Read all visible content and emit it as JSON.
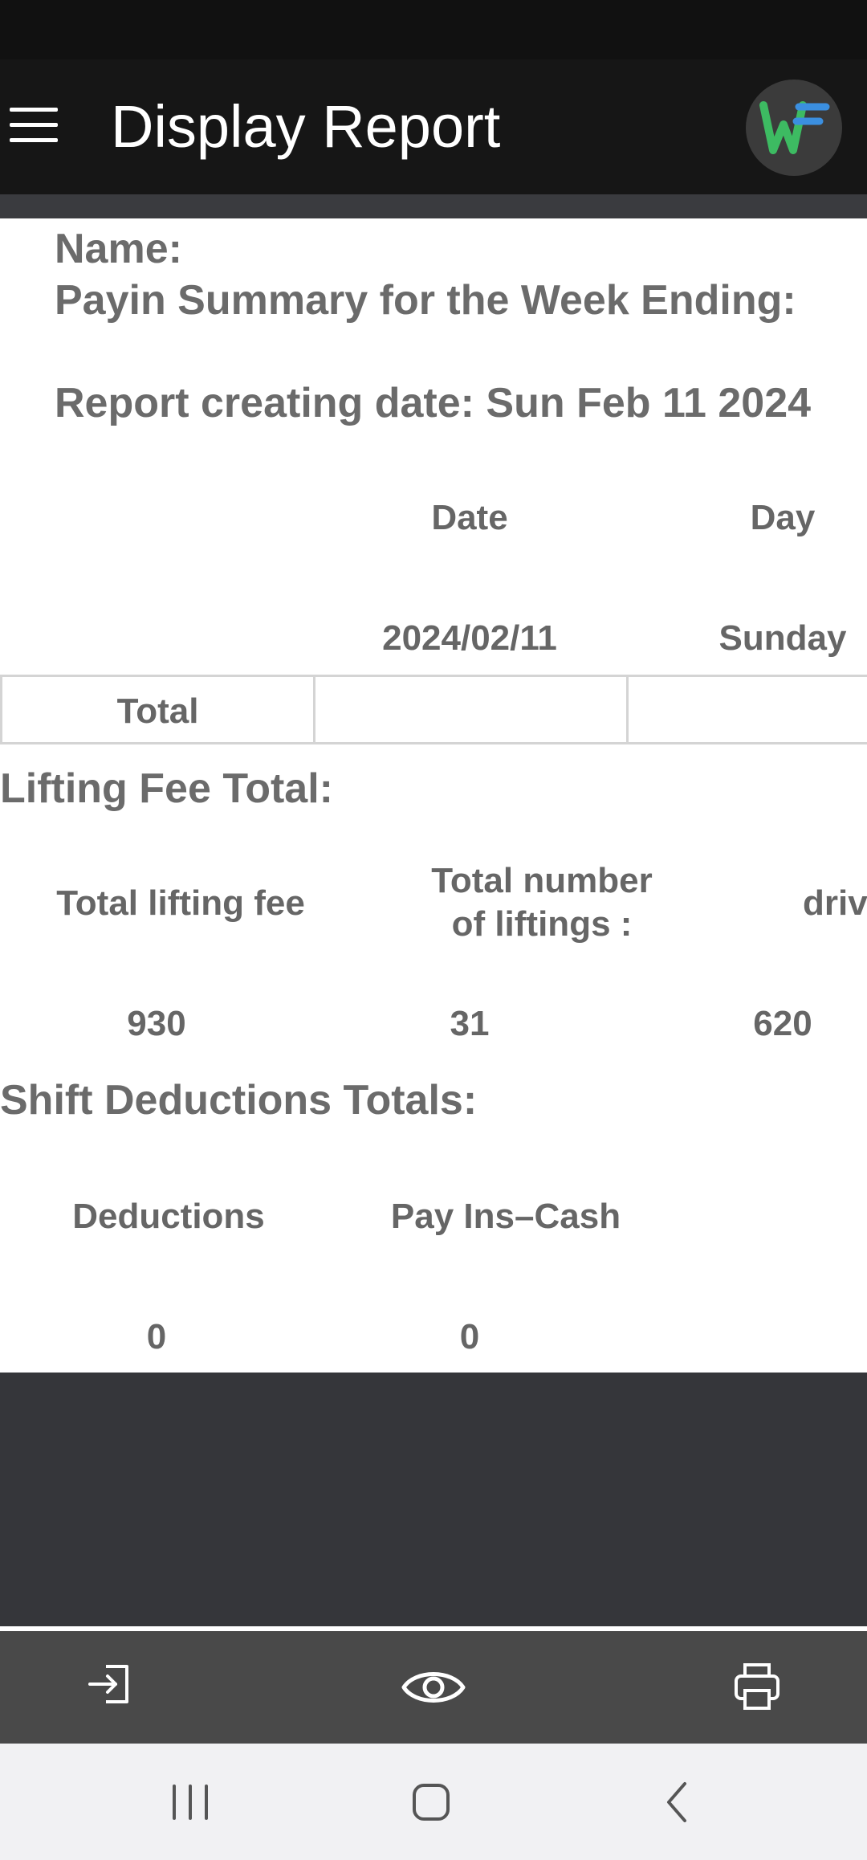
{
  "app_bar": {
    "title": "Display Report",
    "menu_icon": "hamburger-menu-icon",
    "avatar_icon": "wf-logo-icon",
    "avatar_colors": {
      "green": "#3dbb62",
      "blue": "#3b8fe0",
      "bg": "#3b3b3b"
    }
  },
  "report": {
    "name_label": "Name:",
    "summary_label": "Payin Summary for the Week Ending:",
    "created_label": "Report creating date: Sun Feb 11 2024"
  },
  "daily_table": {
    "headers": [
      "Date",
      "Day"
    ],
    "row": [
      "2024/02/11",
      "Sunday"
    ],
    "total_label": "Total",
    "total_values": [
      "",
      ""
    ]
  },
  "lifting_fee": {
    "title": "Lifting Fee Total:",
    "headers": [
      "Total lifting fee",
      "Total number of liftings :",
      "driv"
    ],
    "values": [
      "930",
      "31",
      "620"
    ]
  },
  "shift_deductions": {
    "title": "Shift Deductions Totals:",
    "headers": [
      "Deductions",
      "Pay Ins–Cash"
    ],
    "values": [
      "0",
      "0"
    ]
  },
  "toolbar": {
    "icons": [
      "login-icon",
      "eye-icon",
      "printer-icon"
    ]
  },
  "system_nav": {
    "icons": [
      "recent-apps-icon",
      "home-icon",
      "back-icon"
    ]
  },
  "colors": {
    "app_bar": "#161616",
    "text": "#666666",
    "dark_panel": "#35363a",
    "toolbar": "#494949",
    "nav_bar": "#f1f1f3"
  }
}
